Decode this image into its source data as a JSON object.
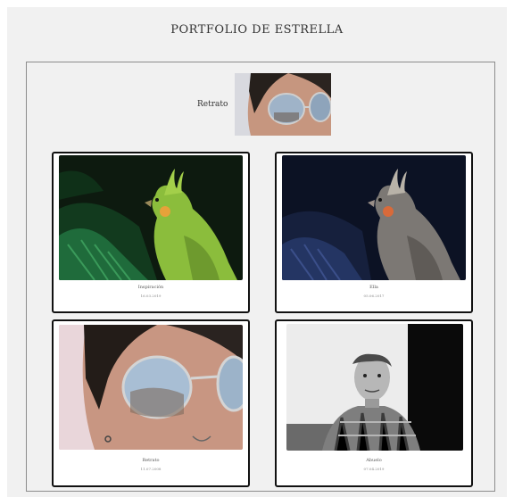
{
  "site": {
    "title": "PORTFOLIO DE ESTRELLA"
  },
  "featured": {
    "label": "Retrato"
  },
  "gallery": [
    {
      "title": "Inspiración",
      "date": "16.03.2019"
    },
    {
      "title": "Ella",
      "date": "05.06.2017"
    },
    {
      "title": "Retrato",
      "date": "11.07.2008"
    },
    {
      "title": "Abuelo",
      "date": "07.04.2019"
    }
  ],
  "colors": {
    "page_bg": "#f1f1f1",
    "card_border": "#111111",
    "frame_border": "#8c8c8c"
  }
}
